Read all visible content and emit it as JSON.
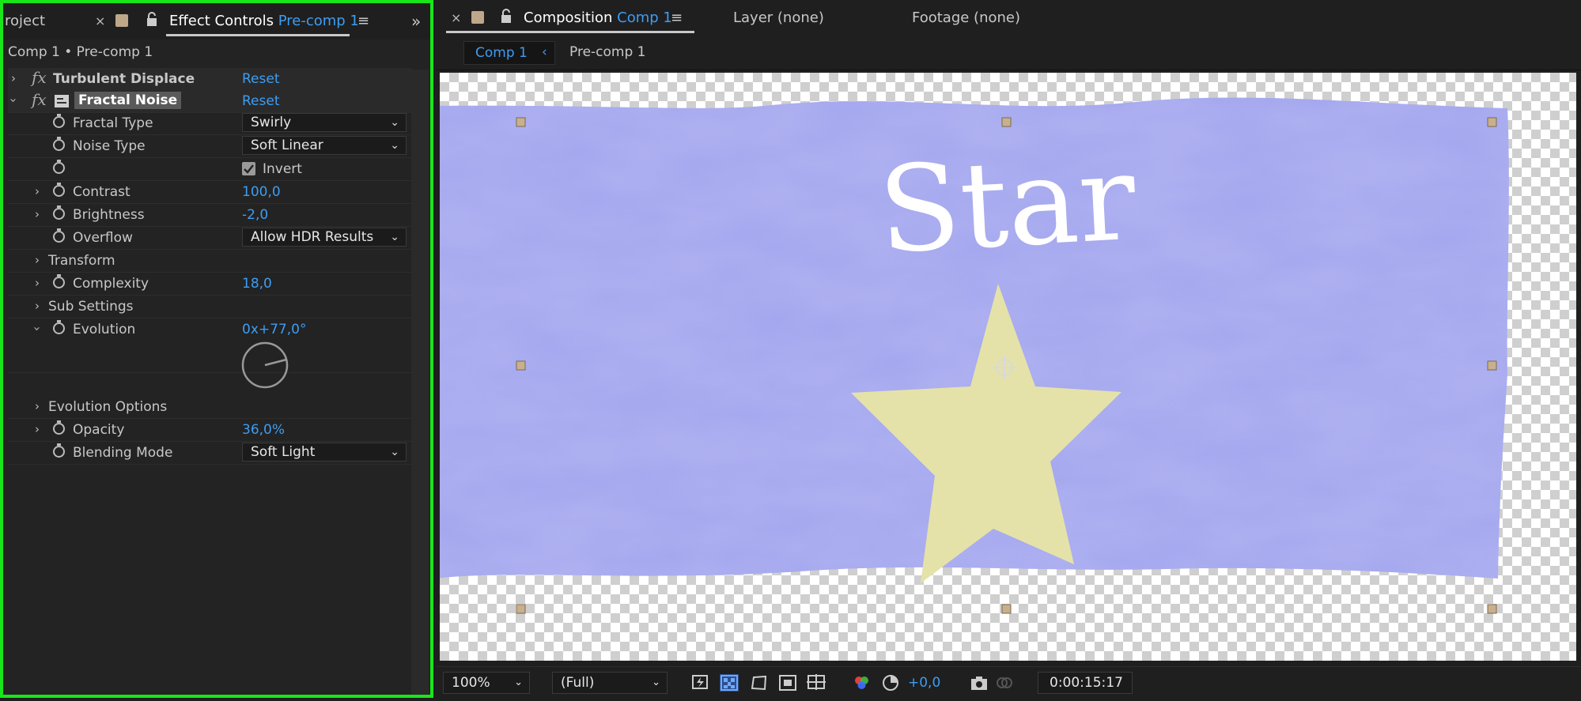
{
  "left_panel": {
    "tab_project": "roject",
    "tab_effect_controls": "Effect Controls",
    "tab_effect_controls_target": "Pre-comp 1",
    "breadcrumb": "Comp 1 • Pre-comp 1",
    "effects": [
      {
        "name": "Turbulent Displace",
        "reset": "Reset"
      },
      {
        "name": "Fractal Noise",
        "reset": "Reset"
      }
    ],
    "props": {
      "fractal_type": {
        "label": "Fractal Type",
        "value": "Swirly"
      },
      "noise_type": {
        "label": "Noise Type",
        "value": "Soft Linear"
      },
      "invert": {
        "label": "Invert",
        "checked": true
      },
      "contrast": {
        "label": "Contrast",
        "value": "100,0"
      },
      "brightness": {
        "label": "Brightness",
        "value": "-2,0"
      },
      "overflow": {
        "label": "Overflow",
        "value": "Allow HDR Results"
      },
      "transform": {
        "label": "Transform"
      },
      "complexity": {
        "label": "Complexity",
        "value": "18,0"
      },
      "sub_settings": {
        "label": "Sub Settings"
      },
      "evolution": {
        "label": "Evolution",
        "value": "0x+77,0°"
      },
      "evolution_options": {
        "label": "Evolution Options"
      },
      "opacity": {
        "label": "Opacity",
        "value": "36,0%"
      },
      "blending_mode": {
        "label": "Blending Mode",
        "value": "Soft Light"
      }
    }
  },
  "right_panel": {
    "tab_composition": "Composition",
    "tab_composition_target": "Comp 1",
    "tab_layer": "Layer (none)",
    "tab_footage": "Footage (none)",
    "flow_comp": "Comp 1",
    "flow_precomp": "Pre-comp 1",
    "canvas_text": "Star",
    "zoom": "100%",
    "resolution": "(Full)",
    "exposure": "+0,0",
    "timecode": "0:00:15:17"
  },
  "colors": {
    "accent_blue": "#3d9df2",
    "selection_green": "#19e619",
    "flag_purple": "#a3a6ee",
    "star_yellow": "#e5e2a9"
  }
}
